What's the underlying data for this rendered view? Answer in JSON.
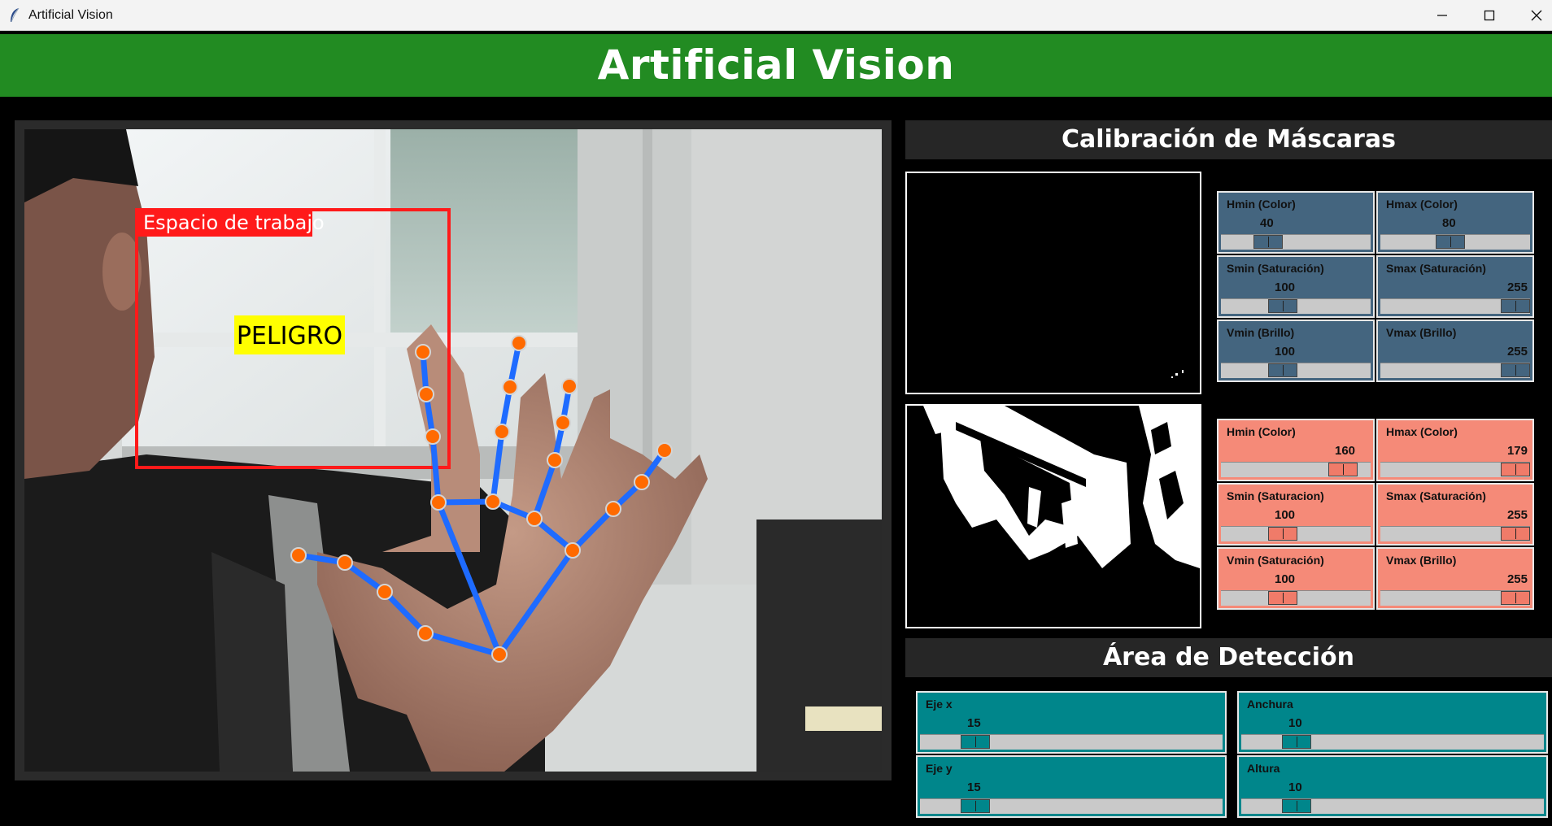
{
  "window": {
    "title": "Artificial Vision"
  },
  "header": {
    "title": "Artificial Vision"
  },
  "camera": {
    "workspace_label": "Espacio de trabajo",
    "warning_label": "PELIGRO"
  },
  "calibration": {
    "title": "Calibración de Máscaras",
    "green_mask": [
      {
        "label": "Hmin (Color)",
        "value": "40",
        "fraction": 0.27
      },
      {
        "label": "Hmax (Color)",
        "value": "80",
        "fraction": 0.46
      },
      {
        "label": "Smin (Saturación)",
        "value": "100",
        "fraction": 0.39
      },
      {
        "label": "Smax (Saturación)",
        "value": "255",
        "fraction": 1.0
      },
      {
        "label": "Vmin (Brillo)",
        "value": "100",
        "fraction": 0.39
      },
      {
        "label": "Vmax (Brillo)",
        "value": "255",
        "fraction": 1.0
      }
    ],
    "red_mask": [
      {
        "label": "Hmin (Color)",
        "value": "160",
        "fraction": 0.89
      },
      {
        "label": "Hmax (Color)",
        "value": "179",
        "fraction": 1.0
      },
      {
        "label": "Smin (Saturacion)",
        "value": "100",
        "fraction": 0.39
      },
      {
        "label": "Smax (Saturación)",
        "value": "255",
        "fraction": 1.0
      },
      {
        "label": "Vmin (Saturación)",
        "value": "100",
        "fraction": 0.39
      },
      {
        "label": "Vmax (Brillo)",
        "value": "255",
        "fraction": 1.0
      }
    ]
  },
  "detection": {
    "title": "Área de Detección",
    "sliders": [
      {
        "label": "Eje x",
        "value": "15",
        "fraction": 0.15
      },
      {
        "label": "Anchura",
        "value": "10",
        "fraction": 0.15
      },
      {
        "label": "Eje y",
        "value": "15",
        "fraction": 0.15
      },
      {
        "label": "Altura",
        "value": "10",
        "fraction": 0.15
      }
    ]
  },
  "colors": {
    "header_green": "#228b22",
    "green_panel": "#44657f",
    "red_panel": "#f58a78",
    "detection_panel": "#00868b",
    "workspace_red": "#ff1a1a",
    "warning_yellow": "#ffff00",
    "landmark_orange": "#ff6a00",
    "connection_blue": "#1e6bff"
  }
}
